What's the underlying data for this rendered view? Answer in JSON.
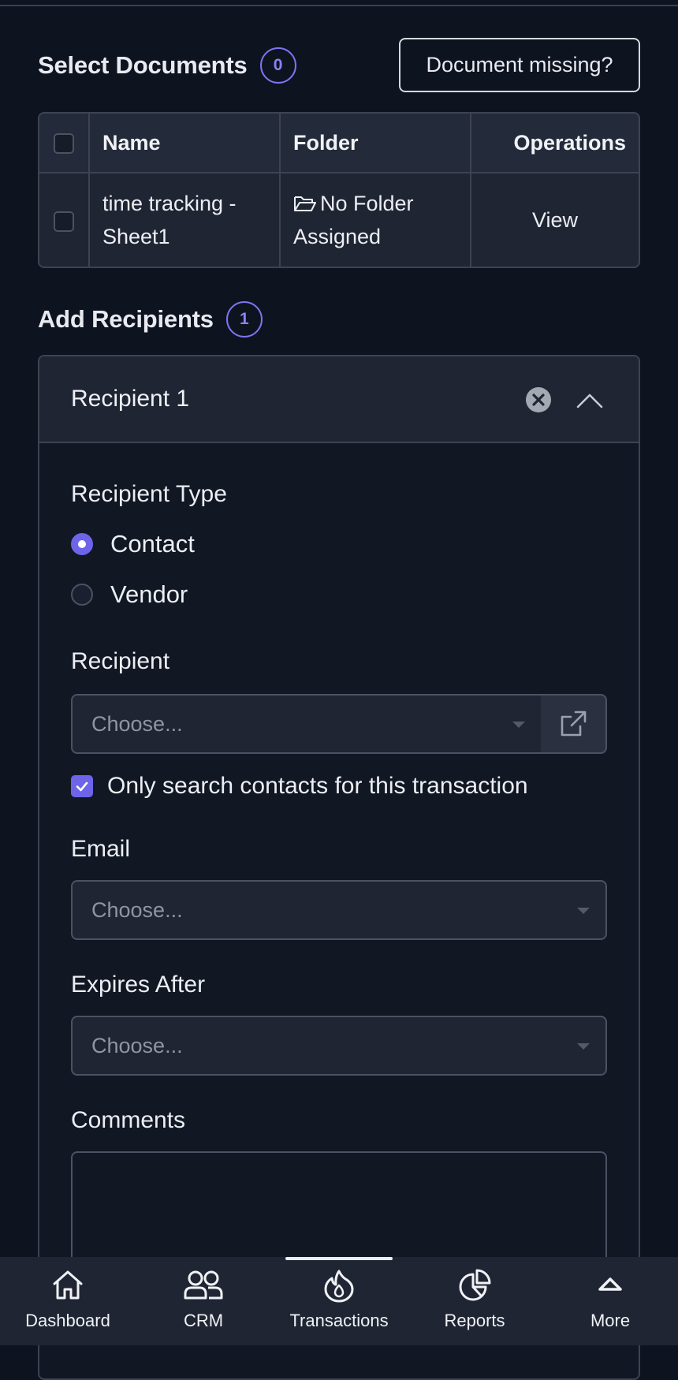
{
  "documents": {
    "title": "Select Documents",
    "count": "0",
    "missing_button": "Document missing?",
    "columns": [
      "Name",
      "Folder",
      "Operations"
    ],
    "rows": [
      {
        "name": "time tracking - Sheet1",
        "folder": "No Folder Assigned",
        "operation": "View"
      }
    ]
  },
  "recipients": {
    "title": "Add Recipients",
    "count": "1",
    "card_title": "Recipient 1",
    "type_label": "Recipient Type",
    "type_options": [
      {
        "label": "Contact",
        "selected": true
      },
      {
        "label": "Vendor",
        "selected": false
      }
    ],
    "recipient_label": "Recipient",
    "recipient_placeholder": "Choose...",
    "only_contacts_label": "Only search contacts for this transaction",
    "only_contacts_checked": true,
    "email_label": "Email",
    "email_placeholder": "Choose...",
    "expires_label": "Expires After",
    "expires_placeholder": "Choose...",
    "comments_label": "Comments"
  },
  "nav": {
    "items": [
      {
        "label": "Dashboard",
        "icon": "home-icon",
        "active": false
      },
      {
        "label": "CRM",
        "icon": "users-icon",
        "active": false
      },
      {
        "label": "Transactions",
        "icon": "flame-icon",
        "active": true
      },
      {
        "label": "Reports",
        "icon": "pie-chart-icon",
        "active": false
      },
      {
        "label": "More",
        "icon": "chevron-up-icon",
        "active": false
      }
    ]
  },
  "colors": {
    "background": "#0e1320",
    "surface": "#1f2533",
    "accent": "#6d64ea",
    "link": "#7f78f2"
  }
}
